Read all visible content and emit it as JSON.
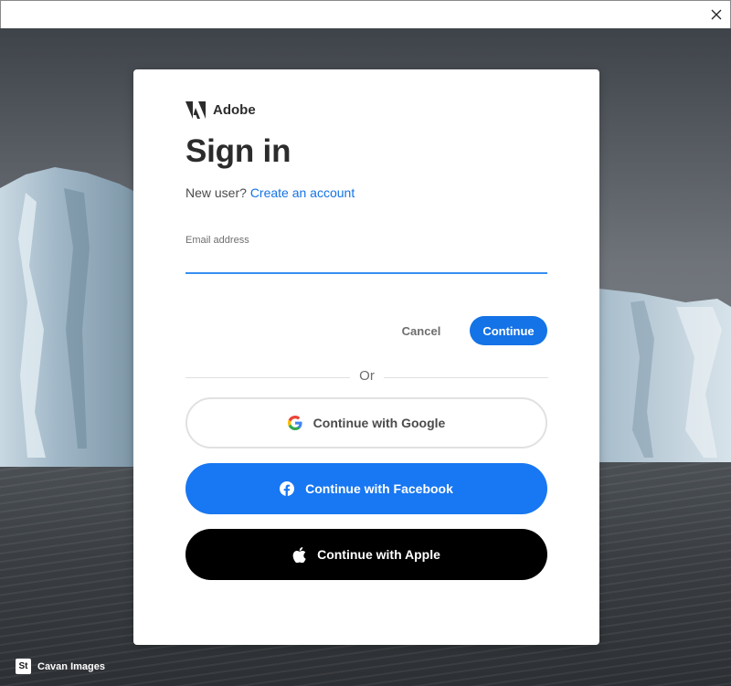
{
  "window": {
    "close_icon": "close-icon"
  },
  "brand": {
    "name": "Adobe",
    "logo_icon": "adobe-logo-icon"
  },
  "signin": {
    "heading": "Sign in",
    "new_user_text": "New user?",
    "create_account_link": "Create an account",
    "email_label": "Email address",
    "email_value": "",
    "cancel_label": "Cancel",
    "continue_label": "Continue",
    "divider_text": "Or",
    "google_label": "Continue with Google",
    "facebook_label": "Continue with Facebook",
    "apple_label": "Continue with Apple"
  },
  "credit": {
    "logo_text": "St",
    "name": "Cavan Images"
  },
  "colors": {
    "accent": "#1473e6",
    "input_underline": "#378ef0",
    "facebook": "#1877f2",
    "apple": "#000000",
    "text": "#2c2c2c"
  }
}
